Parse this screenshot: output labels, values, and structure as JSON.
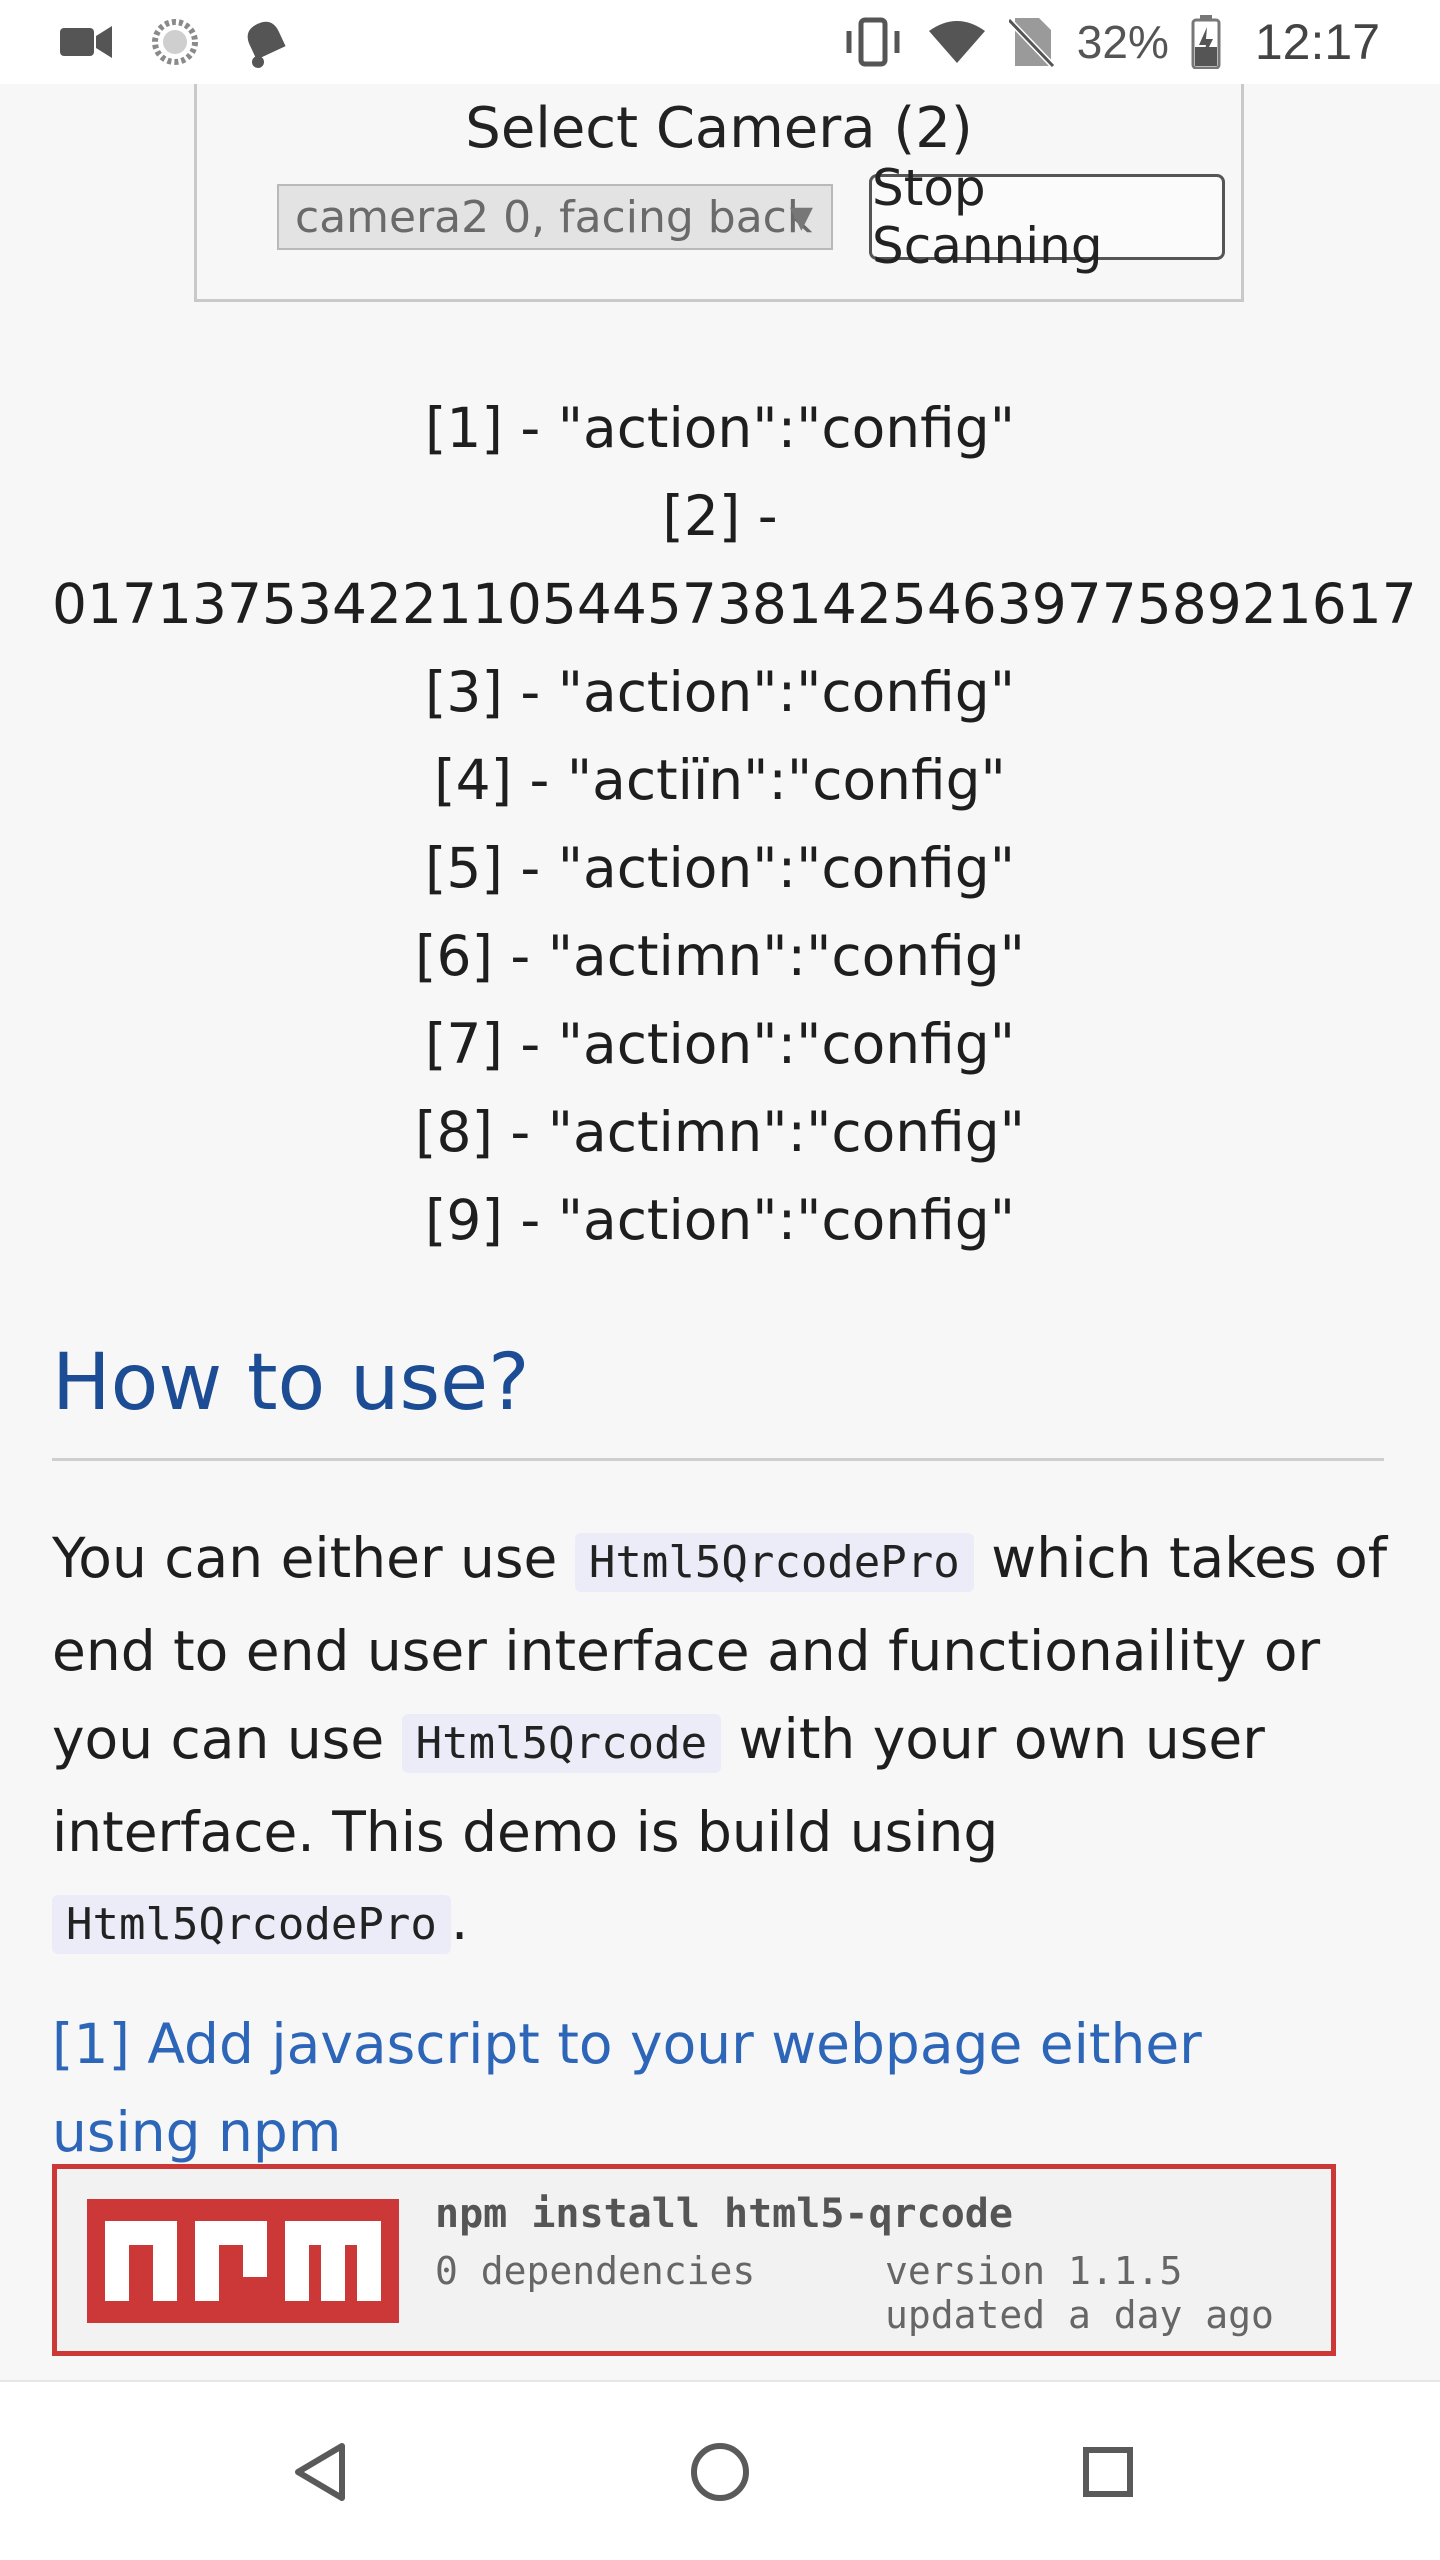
{
  "status_bar": {
    "battery_percent": "32%",
    "clock": "12:17",
    "left_icons": [
      "video-camera-icon",
      "sync-icon",
      "notification-bell-icon"
    ],
    "right_icons": [
      "vibrate-icon",
      "wifi-icon",
      "no-sim-icon",
      "battery-charging-icon"
    ]
  },
  "scanner": {
    "select_camera_label": "Select Camera (2)",
    "camera_selected": "camera2 0, facing back",
    "stop_button_label": "Stop Scanning"
  },
  "results": [
    "[1] - \"action\":\"config\"",
    "[2] -",
    "017137534221105445738142546397758921617",
    "[3] - \"action\":\"config\"",
    "[4] - \"actiïn\":\"config\"",
    "[5] - \"action\":\"config\"",
    "[6] - \"actimn\":\"config\"",
    "[7] - \"action\":\"config\"",
    "[8] - \"actimn\":\"config\"",
    "[9] - \"action\":\"config\""
  ],
  "how_to_use": {
    "title": "How to use?",
    "p1_a": "You can either use ",
    "code_pro": "Html5QrcodePro",
    "p1_b": " which takes of end to end user interface and functionaility or you can use ",
    "code_basic": "Html5Qrcode",
    "p1_c": " with your own user interface. This demo is build using ",
    "code_pro_2": "Html5QrcodePro",
    "p1_d": ".",
    "step1_link": "[1] Add javascript to your webpage either using npm"
  },
  "npm_badge": {
    "logo_text": "npm",
    "command": "npm install html5-qrcode",
    "dependencies": "0 dependencies",
    "version": "version 1.1.5",
    "updated": "updated a day ago"
  },
  "colors": {
    "heading": "#1c4c93",
    "link": "#2d66b8",
    "npm_red": "#cb3837",
    "code_bg": "#ececf8"
  },
  "nav_bar": {
    "icons": [
      "back-icon",
      "home-icon",
      "recents-icon"
    ]
  }
}
